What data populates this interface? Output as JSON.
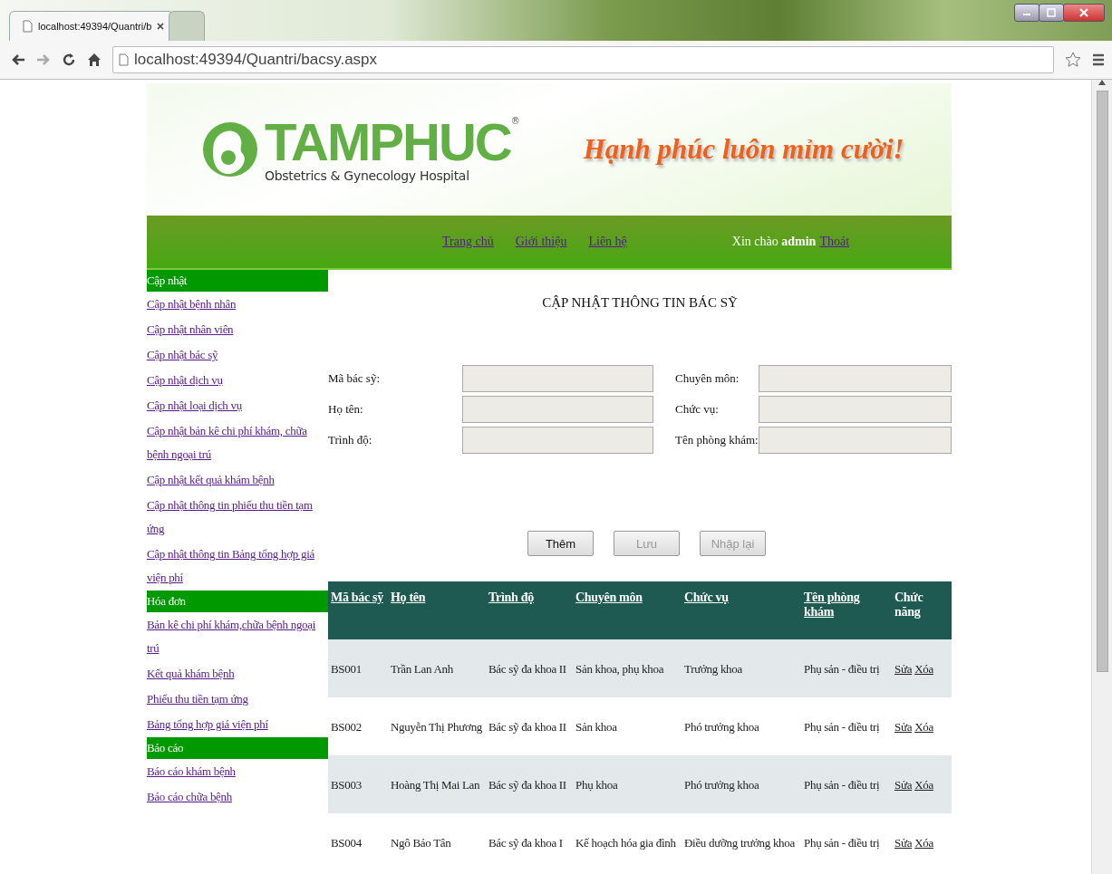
{
  "browser": {
    "tabs": [
      {
        "title": "localhost:49394/Quantri/b",
        "selected": true
      },
      {
        "selected": false
      }
    ],
    "address": "localhost:49394/Quantri/bacsy.aspx"
  },
  "header": {
    "logo_name": "TAMPHUC",
    "logo_mark": "®",
    "logo_subtitle": "Obstetrics & Gynecology Hospital",
    "slogan": "Hạnh phúc luôn mỉm cười!"
  },
  "nav": {
    "links": [
      "Trang chủ",
      "Giới thiệu",
      "Liên hệ"
    ],
    "greeting": "Xin chào **admin**",
    "logout": "Thoát"
  },
  "sidebar": {
    "sections": [
      {
        "title": "Cập nhật",
        "items": [
          "Cập nhật bệnh nhân",
          "Cập nhật nhân viên",
          "Cập nhật bác sỹ",
          "Cập nhật dịch vụ",
          "Cập nhật loại dịch vụ",
          "Cập nhật bản kê chi phí khám, chữa bệnh ngoại trú",
          "Cập nhật kết quả khám bệnh",
          "Cập nhật thông tin phiếu thu tiền tạm ứng",
          "Cập nhật thông tin Bảng tổng hợp giá viện phí"
        ]
      },
      {
        "title": "Hóa đơn",
        "items": [
          "Bản kê chi phí khám,chữa bệnh ngoại trú",
          "Kết quả khám bệnh",
          "Phiếu thu tiền tạm ứng",
          "Bảng tổng hợp giá viện phí"
        ]
      },
      {
        "title": "Báo cáo",
        "items": [
          "Báo cáo khám bệnh",
          "Báo cáo chữa bệnh"
        ]
      }
    ]
  },
  "form": {
    "title": "CẬP NHẬT THÔNG TIN BÁC SỸ",
    "fields": [
      {
        "label": "Mã bác sỹ:",
        "disabled": true
      },
      {
        "label": "Chuyên môn:",
        "disabled": true
      },
      {
        "label": "Họ tên:",
        "disabled": true
      },
      {
        "label": "Chức vụ:",
        "disabled": true
      },
      {
        "label": "Trình độ:",
        "disabled": true
      },
      {
        "label": "Tên phòng khám:",
        "disabled": true
      }
    ],
    "buttons": [
      {
        "label": "Thêm",
        "disabled": false
      },
      {
        "label": "Lưu",
        "disabled": true
      },
      {
        "label": "Nhập lại",
        "disabled": true
      }
    ]
  },
  "table": {
    "columns": [
      {
        "label": "Mã bác sỹ",
        "link": true
      },
      {
        "label": "Họ tên",
        "link": true
      },
      {
        "label": "Trình độ",
        "link": true
      },
      {
        "label": "Chuyên môn",
        "link": true
      },
      {
        "label": "Chức vụ",
        "link": true
      },
      {
        "label": "Tên phòng khám",
        "link": true
      },
      {
        "label": "Chức năng",
        "link": false
      }
    ],
    "rows": [
      {
        "cells": [
          "BS001",
          "Trần Lan Anh",
          "Bác sỹ đa khoa II",
          "Sản khoa, phụ khoa",
          "Trưởng khoa",
          "Phụ sản - điều trị"
        ],
        "actions": [
          "Sửa",
          "Xóa"
        ]
      },
      {
        "cells": [
          "BS002",
          "Nguyễn Thị Phương",
          "Bác sỹ đa khoa II",
          "Sản khoa",
          "Phó trưởng khoa",
          "Phụ sản - điều trị"
        ],
        "actions": [
          "Sửa",
          "Xóa"
        ]
      },
      {
        "cells": [
          "BS003",
          "Hoàng Thị Mai Lan",
          "Bác sỹ đa khoa II",
          "Phụ khoa",
          "Phó trưởng khoa",
          "Phụ sản - điều trị"
        ],
        "actions": [
          "Sửa",
          "Xóa"
        ]
      },
      {
        "cells": [
          "BS004",
          "Ngô Bảo Tân",
          "Bác sỹ đa khoa I",
          "Kế hoạch hóa gia đình",
          "Điều dưỡng trưởng khoa",
          "Phụ sản - điều trị"
        ],
        "actions": [
          "Sửa",
          "Xóa"
        ]
      }
    ]
  }
}
